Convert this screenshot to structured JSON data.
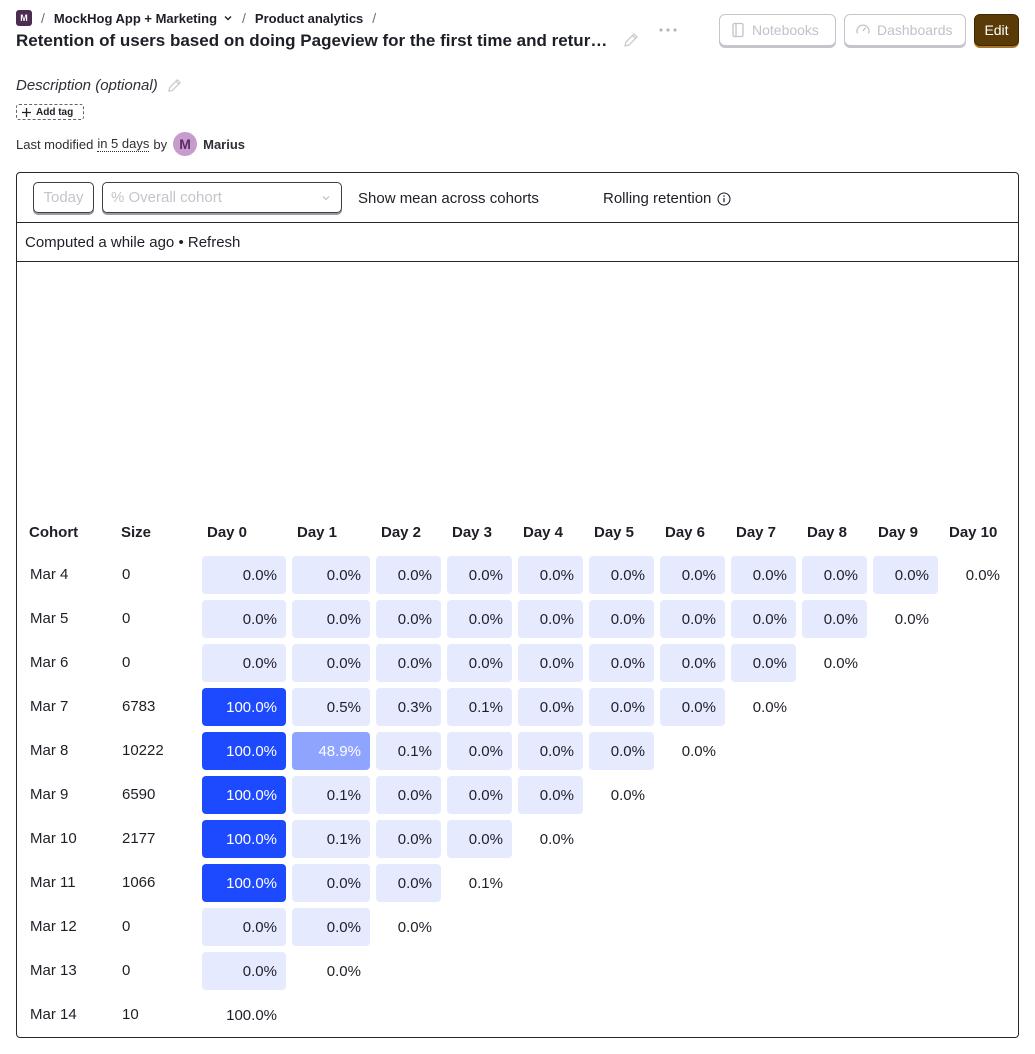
{
  "breadcrumbs": {
    "project_icon_letter": "M",
    "project": "MockHog App + Marketing",
    "section": "Product analytics"
  },
  "title": "Retention of users based on doing Pageview for the first time and returni...",
  "header_buttons": {
    "notebooks": "Notebooks",
    "dashboards": "Dashboards",
    "edit": "Edit"
  },
  "description_placeholder": "Description (optional)",
  "add_tag": "Add tag",
  "last_modified": {
    "prefix": "Last modified",
    "when": "in 5 days",
    "by": "by",
    "avatar_letter": "M",
    "user": "Marius"
  },
  "toolbar": {
    "date_button": "Today",
    "display_select": "% Overall cohort",
    "show_mean": "Show mean across cohorts",
    "rolling": "Rolling retention"
  },
  "status": {
    "computed": "Computed a while ago",
    "bullet": "•",
    "refresh": "Refresh"
  },
  "table": {
    "columns": [
      "Cohort",
      "Size",
      "Day 0",
      "Day 1",
      "Day 2",
      "Day 3",
      "Day 4",
      "Day 5",
      "Day 6",
      "Day 7",
      "Day 8",
      "Day 9",
      "Day 10"
    ],
    "rows": [
      {
        "cohort": "Mar 4",
        "size": "0",
        "values": [
          0.0,
          0.0,
          0.0,
          0.0,
          0.0,
          0.0,
          0.0,
          0.0,
          0.0,
          0.0,
          0.0
        ]
      },
      {
        "cohort": "Mar 5",
        "size": "0",
        "values": [
          0.0,
          0.0,
          0.0,
          0.0,
          0.0,
          0.0,
          0.0,
          0.0,
          0.0,
          0.0
        ]
      },
      {
        "cohort": "Mar 6",
        "size": "0",
        "values": [
          0.0,
          0.0,
          0.0,
          0.0,
          0.0,
          0.0,
          0.0,
          0.0,
          0.0
        ]
      },
      {
        "cohort": "Mar 7",
        "size": "6783",
        "values": [
          100.0,
          0.5,
          0.3,
          0.1,
          0.0,
          0.0,
          0.0,
          0.0
        ]
      },
      {
        "cohort": "Mar 8",
        "size": "10222",
        "values": [
          100.0,
          48.9,
          0.1,
          0.0,
          0.0,
          0.0,
          0.0
        ]
      },
      {
        "cohort": "Mar 9",
        "size": "6590",
        "values": [
          100.0,
          0.1,
          0.0,
          0.0,
          0.0,
          0.0
        ]
      },
      {
        "cohort": "Mar 10",
        "size": "2177",
        "values": [
          100.0,
          0.1,
          0.0,
          0.0,
          0.0
        ]
      },
      {
        "cohort": "Mar 11",
        "size": "1066",
        "values": [
          100.0,
          0.0,
          0.0,
          0.1
        ]
      },
      {
        "cohort": "Mar 12",
        "size": "0",
        "values": [
          0.0,
          0.0,
          0.0
        ]
      },
      {
        "cohort": "Mar 13",
        "size": "0",
        "values": [
          0.0,
          0.0
        ]
      },
      {
        "cohort": "Mar 14",
        "size": "10",
        "values": [
          100.0
        ]
      }
    ]
  },
  "colors": {
    "accent_brand": "#5a3a07",
    "cell_strong": "#1d4aff",
    "cell_mid": "#8ea4ff",
    "cell_light": "#e6eaff"
  }
}
